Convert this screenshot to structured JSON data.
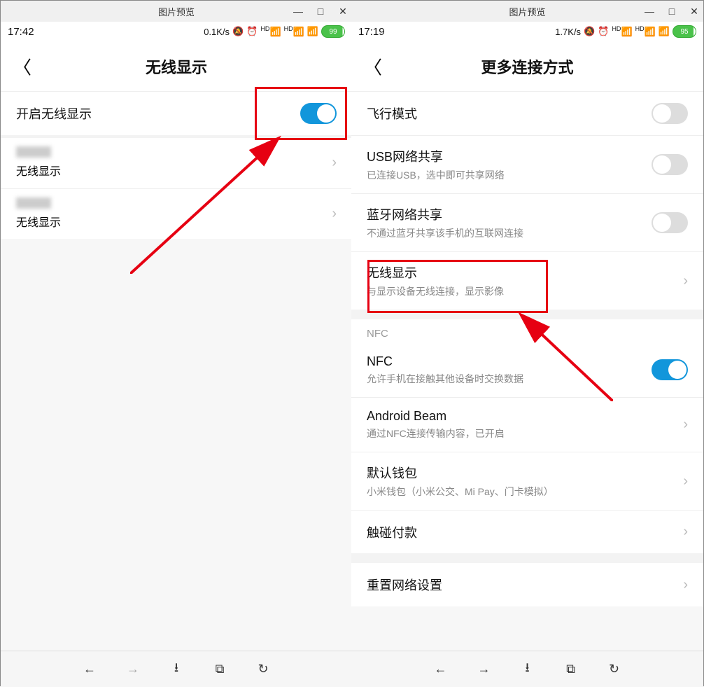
{
  "left": {
    "window_title": "图片预览",
    "time": "17:42",
    "net_speed": "0.1K/s",
    "battery": "99",
    "page_title": "无线显示",
    "toggle_row": {
      "label": "开启无线显示",
      "on": true
    },
    "devices": [
      {
        "sub": "无线显示"
      },
      {
        "sub": "无线显示"
      }
    ]
  },
  "right": {
    "window_title": "图片预览",
    "time": "17:19",
    "net_speed": "1.7K/s",
    "battery": "95",
    "page_title": "更多连接方式",
    "rows": [
      {
        "key": "airplane",
        "title": "飞行模式",
        "sub": "",
        "type": "toggle",
        "on": false
      },
      {
        "key": "usb",
        "title": "USB网络共享",
        "sub": "已连接USB，选中即可共享网络",
        "type": "toggle",
        "on": false
      },
      {
        "key": "bt",
        "title": "蓝牙网络共享",
        "sub": "不通过蓝牙共享该手机的互联网连接",
        "type": "toggle",
        "on": false
      },
      {
        "key": "wireless_display",
        "title": "无线显示",
        "sub": "与显示设备无线连接，显示影像",
        "type": "arrow"
      }
    ],
    "nfc_header": "NFC",
    "nfc_rows": [
      {
        "key": "nfc",
        "title": "NFC",
        "sub": "允许手机在接触其他设备时交换数据",
        "type": "toggle",
        "on": true
      },
      {
        "key": "beam",
        "title": "Android Beam",
        "sub": "通过NFC连接传输内容，已开启",
        "type": "arrow"
      },
      {
        "key": "wallet",
        "title": "默认钱包",
        "sub": "小米钱包（小米公交、Mi Pay、门卡模拟）",
        "type": "arrow"
      },
      {
        "key": "tap_pay",
        "title": "触碰付款",
        "sub": "",
        "type": "arrow"
      }
    ],
    "reset_row": {
      "title": "重置网络设置"
    }
  },
  "bottombar_icons": [
    "←",
    "→",
    "⭳",
    "⧉",
    "↻"
  ]
}
